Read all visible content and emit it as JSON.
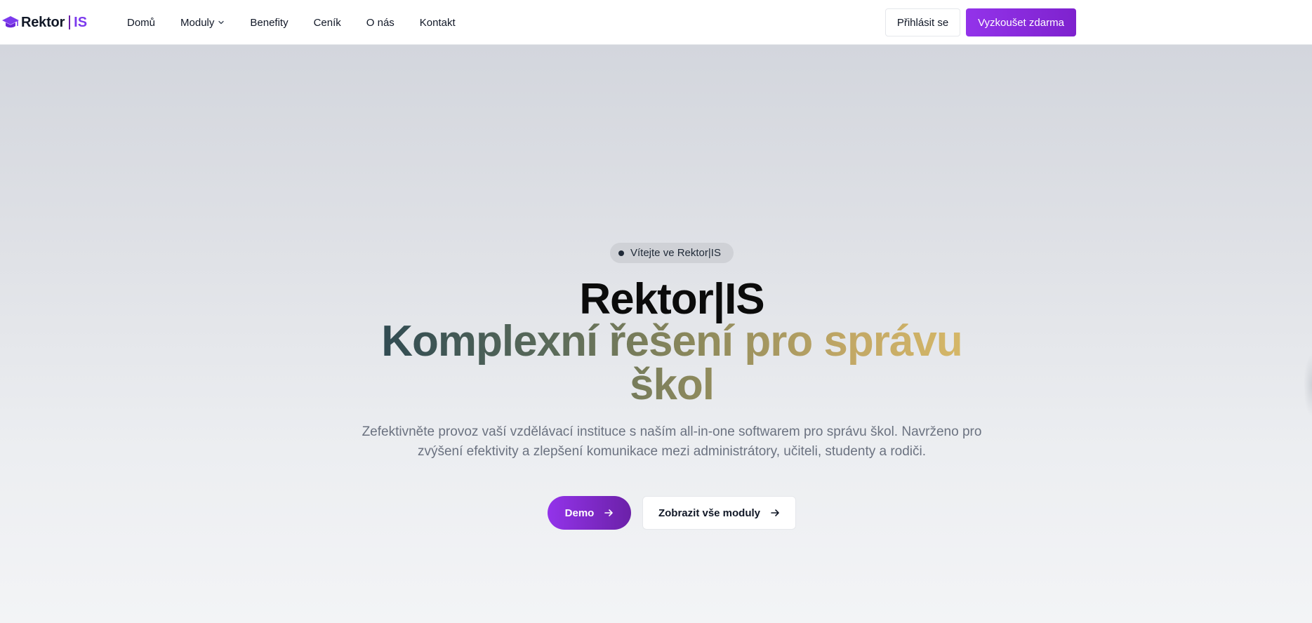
{
  "brand": {
    "name": "Rektor",
    "suffix": "IS",
    "accent_color": "#7c3aed",
    "logo_icon": "graduation-cap-icon"
  },
  "nav": {
    "items": [
      {
        "label": "Domů"
      },
      {
        "label": "Moduly",
        "icon": "chevron-down-icon"
      },
      {
        "label": "Benefity"
      },
      {
        "label": "Ceník"
      },
      {
        "label": "O nás"
      },
      {
        "label": "Kontakt"
      }
    ],
    "login_label": "Přihlásit se",
    "trial_label": "Vyzkoušet zdarma"
  },
  "hero": {
    "badge": "Vítejte ve Rektor|IS",
    "title": "Rektor|IS",
    "subtitle": "Komplexní řešení pro správu škol",
    "description": "Zefektivněte provoz vaší vzdělávací instituce s naším all-in-one softwarem pro správu škol. Navrženo pro zvýšení efektivity a zlepšení komunikace mezi administrátory, učiteli, studenty a rodiči.",
    "demo_label": "Demo",
    "modules_label": "Zobrazit vše moduly",
    "button_icon": "arrow-right-icon",
    "gradient_colors": [
      "#2f4a52",
      "#8e8a5c",
      "#d6b868"
    ]
  }
}
